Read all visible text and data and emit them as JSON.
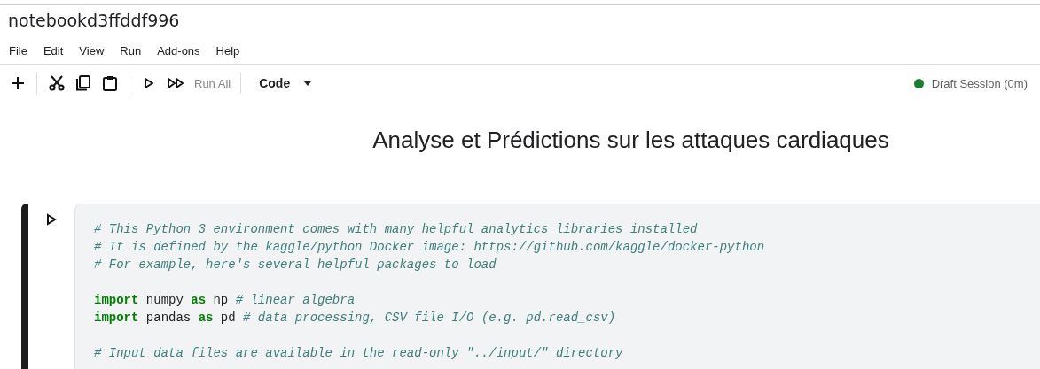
{
  "notebook": {
    "title": "notebookd3ffddf996"
  },
  "menu": [
    "File",
    "Edit",
    "View",
    "Run",
    "Add-ons",
    "Help"
  ],
  "toolbar": [
    {
      "kind": "add"
    },
    {
      "kind": "sep"
    },
    {
      "kind": "cut"
    },
    {
      "kind": "copy"
    },
    {
      "kind": "paste"
    },
    {
      "kind": "sep"
    },
    {
      "kind": "run"
    },
    {
      "kind": "runall",
      "label": "Run All"
    },
    {
      "kind": "sep"
    }
  ],
  "cell_type": {
    "label": "Code"
  },
  "session": {
    "label": "Draft Session (0m)"
  },
  "heading": "Analyse et Prédictions sur les attaques cardiaques",
  "cell": {
    "lines": [
      {
        "kind": "code",
        "tokens": [
          {
            "kind": "comment",
            "text": "# This Python 3 environment comes with many helpful analytics libraries installed"
          }
        ]
      },
      {
        "kind": "code",
        "tokens": [
          {
            "kind": "comment",
            "text": "# It is defined by the kaggle/python Docker image: https://github.com/kaggle/docker-python"
          }
        ]
      },
      {
        "kind": "code",
        "tokens": [
          {
            "kind": "comment",
            "text": "# For example, here's several helpful packages to load"
          }
        ]
      },
      {
        "kind": "blank"
      },
      {
        "kind": "code",
        "tokens": [
          {
            "kind": "keyword",
            "text": "import"
          },
          {
            "kind": "plain",
            "text": " numpy "
          },
          {
            "kind": "keyword",
            "text": "as"
          },
          {
            "kind": "plain",
            "text": " np "
          },
          {
            "kind": "comment",
            "text": "# linear algebra"
          }
        ]
      },
      {
        "kind": "code",
        "tokens": [
          {
            "kind": "keyword",
            "text": "import"
          },
          {
            "kind": "plain",
            "text": " pandas "
          },
          {
            "kind": "keyword",
            "text": "as"
          },
          {
            "kind": "plain",
            "text": " pd "
          },
          {
            "kind": "comment",
            "text": "# data processing, CSV file I/O (e.g. pd.read_csv)"
          }
        ]
      },
      {
        "kind": "blank"
      },
      {
        "kind": "code",
        "tokens": [
          {
            "kind": "comment",
            "text": "# Input data files are available in the read-only \"../input/\" directory"
          }
        ]
      }
    ]
  }
}
